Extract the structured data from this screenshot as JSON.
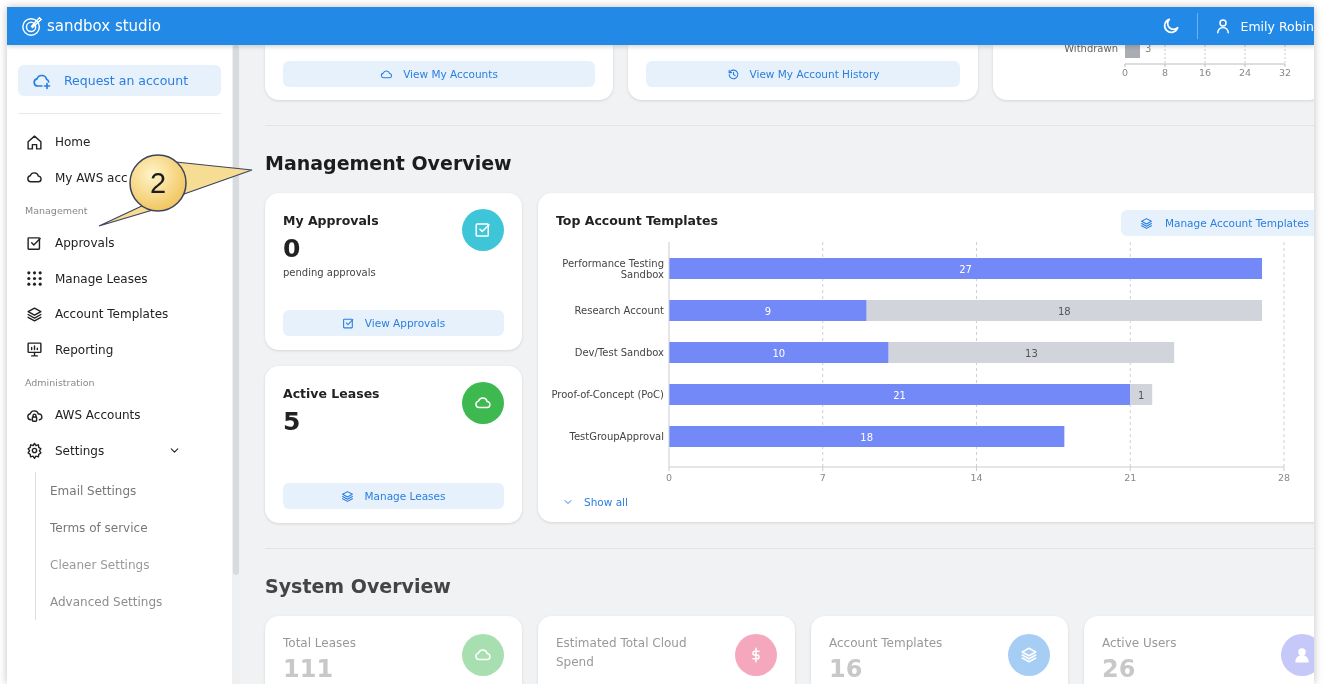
{
  "header": {
    "brand": "sandbox studio",
    "user_name": "Emily Robin"
  },
  "sidebar": {
    "request_button": "Request an account",
    "groups": [
      {
        "items": [
          {
            "label": "Home"
          },
          {
            "label": "My AWS acc"
          }
        ]
      },
      {
        "heading": "Management",
        "items": [
          {
            "label": "Approvals"
          },
          {
            "label": "Manage Leases"
          },
          {
            "label": "Account Templates"
          },
          {
            "label": "Reporting"
          }
        ]
      },
      {
        "heading": "Administration",
        "items": [
          {
            "label": "AWS Accounts"
          },
          {
            "label": "Settings",
            "expanded": true,
            "children": [
              {
                "label": "Email Settings"
              },
              {
                "label": "Terms of service"
              },
              {
                "label": "Cleaner Settings"
              },
              {
                "label": "Advanced Settings"
              }
            ]
          }
        ]
      }
    ]
  },
  "top_cards": [
    {
      "button": "View My Accounts"
    },
    {
      "button": "View My Account History"
    },
    {
      "chart_data": {
        "type": "bar",
        "orientation": "horizontal",
        "categories": [
          "Withdrawn"
        ],
        "values": [
          3
        ],
        "xlim": [
          0,
          32
        ],
        "xticks": [
          0,
          8,
          16,
          24,
          32
        ],
        "data_labels": true
      }
    }
  ],
  "management": {
    "title": "Management Overview",
    "cards": [
      {
        "title": "My Approvals",
        "value": "0",
        "caption": "pending approvals",
        "button": "View Approvals"
      },
      {
        "title": "Active Leases",
        "value": "5",
        "button": "Manage Leases"
      }
    ],
    "chart_card": {
      "title": "Top Account Templates",
      "button": "Manage Account Templates",
      "show_all": "Show all",
      "chart_data": {
        "type": "bar",
        "orientation": "horizontal",
        "stacked": true,
        "categories": [
          "Performance Testing Sandbox",
          "Research Account",
          "Dev/Test Sandbox",
          "Proof-of-Concept (PoC)",
          "TestGroupApproval"
        ],
        "series": [
          {
            "color": "#7489f8",
            "values": [
              27,
              9,
              10,
              21,
              18
            ]
          },
          {
            "color": "#d1d5db",
            "values": [
              null,
              18,
              13,
              1,
              null
            ]
          }
        ],
        "xlim": [
          0,
          28
        ],
        "xticks": [
          0,
          7,
          14,
          21,
          28
        ],
        "grid": true,
        "data_labels": true
      }
    }
  },
  "system": {
    "title": "System Overview",
    "cards": [
      {
        "title": "Total Leases",
        "value": "111"
      },
      {
        "title": "Estimated Total Cloud Spend"
      },
      {
        "title": "Account Templates",
        "value": "16"
      },
      {
        "title": "Active Users",
        "value": "26"
      }
    ]
  },
  "callout": {
    "number": "2"
  }
}
